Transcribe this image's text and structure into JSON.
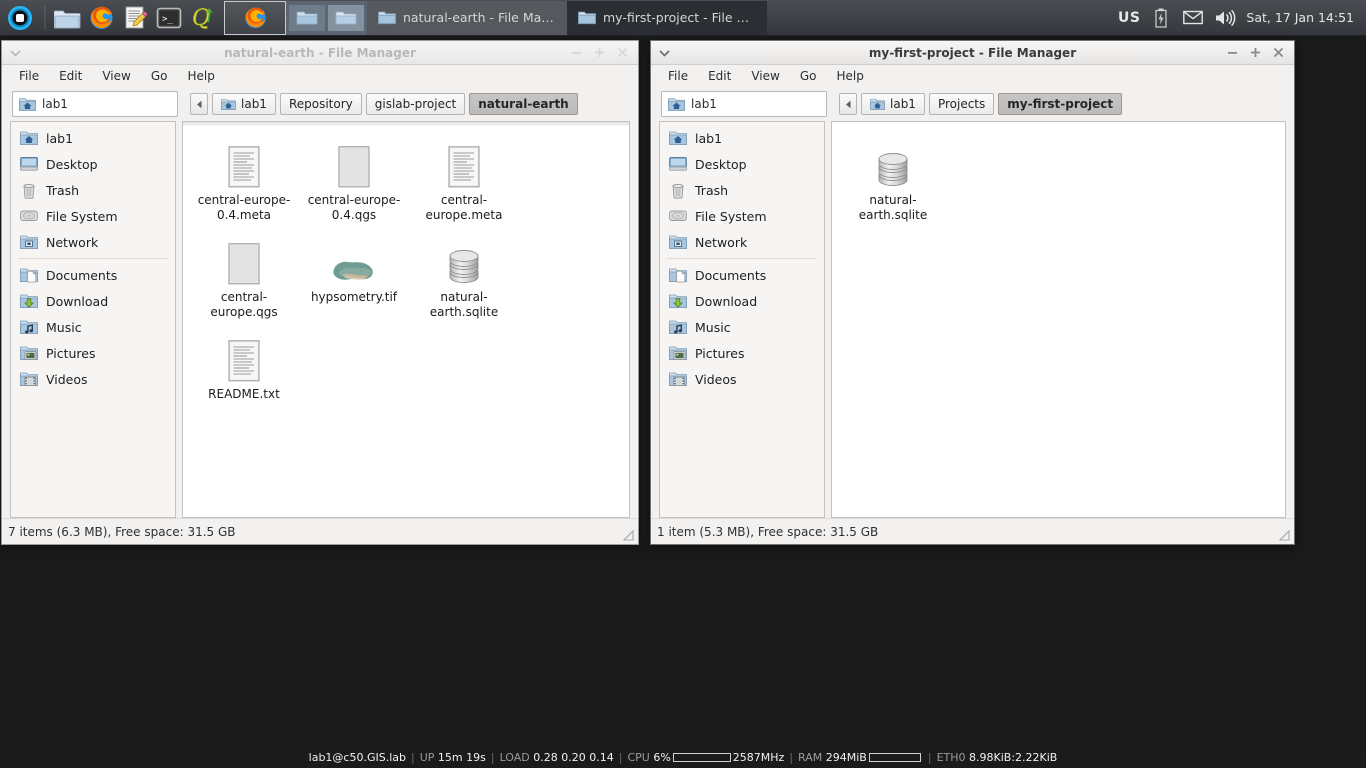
{
  "panel": {
    "launchers": [
      {
        "name": "app-menu-icon",
        "label": "Applications"
      },
      {
        "name": "file-manager-icon",
        "label": "File Manager"
      },
      {
        "name": "firefox-icon",
        "label": "Firefox"
      },
      {
        "name": "text-editor-icon",
        "label": "Text Editor"
      },
      {
        "name": "terminal-icon",
        "label": "Terminal"
      },
      {
        "name": "qgis-icon",
        "label": "QGIS"
      }
    ],
    "window_buttons": [
      {
        "name": "firefox-window-button",
        "label": "",
        "state": "active"
      },
      {
        "name": "natural-earth-window-button",
        "label": "natural-earth - File Manager",
        "state": "inactive"
      },
      {
        "name": "my-first-project-window-button",
        "label": "my-first-project - File Mana...",
        "state": "current"
      }
    ],
    "tray": {
      "keyboard_layout": "US",
      "battery_label": "battery",
      "mail_label": "mail",
      "volume_label": "volume",
      "clock": "Sat, 17 Jan  14:51"
    }
  },
  "menu": [
    "File",
    "Edit",
    "View",
    "Go",
    "Help"
  ],
  "windows": [
    {
      "id": "natural-earth",
      "title": "natural-earth - File Manager",
      "focused": false,
      "location_entry": "lab1",
      "breadcrumbs": [
        "lab1",
        "Repository",
        "gislab-project",
        "natural-earth"
      ],
      "active_breadcrumb": "natural-earth",
      "sidebar": [
        {
          "label": "lab1",
          "icon": "home-folder-icon"
        },
        {
          "label": "Desktop",
          "icon": "desktop-icon"
        },
        {
          "label": "Trash",
          "icon": "trash-icon"
        },
        {
          "label": "File System",
          "icon": "harddisk-icon"
        },
        {
          "label": "Network",
          "icon": "network-icon"
        },
        {
          "label": "Documents",
          "icon": "documents-folder-icon"
        },
        {
          "label": "Download",
          "icon": "download-folder-icon"
        },
        {
          "label": "Music",
          "icon": "music-folder-icon"
        },
        {
          "label": "Pictures",
          "icon": "pictures-folder-icon"
        },
        {
          "label": "Videos",
          "icon": "videos-folder-icon"
        }
      ],
      "files": [
        {
          "label": "central-europe-0.4.meta",
          "icon": "text-file-icon"
        },
        {
          "label": "central-europe-0.4.qgs",
          "icon": "blank-file-icon"
        },
        {
          "label": "central-europe.meta",
          "icon": "text-file-icon"
        },
        {
          "label": "central-europe.qgs",
          "icon": "blank-file-icon"
        },
        {
          "label": "hypsometry.tif",
          "icon": "raster-thumbnail-icon"
        },
        {
          "label": "natural-earth.sqlite",
          "icon": "database-icon"
        },
        {
          "label": "README.txt",
          "icon": "text-file-icon"
        }
      ],
      "status": "7 items (6.3 MB), Free space: 31.5 GB"
    },
    {
      "id": "my-first-project",
      "title": "my-first-project - File Manager",
      "focused": true,
      "location_entry": "lab1",
      "breadcrumbs": [
        "lab1",
        "Projects",
        "my-first-project"
      ],
      "active_breadcrumb": "my-first-project",
      "sidebar": [
        {
          "label": "lab1",
          "icon": "home-folder-icon"
        },
        {
          "label": "Desktop",
          "icon": "desktop-icon"
        },
        {
          "label": "Trash",
          "icon": "trash-icon"
        },
        {
          "label": "File System",
          "icon": "harddisk-icon"
        },
        {
          "label": "Network",
          "icon": "network-icon"
        },
        {
          "label": "Documents",
          "icon": "documents-folder-icon"
        },
        {
          "label": "Download",
          "icon": "download-folder-icon"
        },
        {
          "label": "Music",
          "icon": "music-folder-icon"
        },
        {
          "label": "Pictures",
          "icon": "pictures-folder-icon"
        },
        {
          "label": "Videos",
          "icon": "videos-folder-icon"
        }
      ],
      "files": [
        {
          "label": "natural-earth.sqlite",
          "icon": "database-icon"
        }
      ],
      "status": "1 item (5.3 MB), Free space: 31.5 GB"
    }
  ],
  "bottom_bar": {
    "host": "lab1@c50.GIS.lab",
    "uptime_key": "UP",
    "uptime_value": "15m 19s",
    "load_key": "LOAD",
    "load_value": "0.28 0.20 0.14",
    "cpu_key": "CPU",
    "cpu_value": "6%",
    "cpu_freq": "2587MHz",
    "ram_key": "RAM",
    "ram_value": "294MiB",
    "eth_key": "ETH0",
    "eth_value": "8.98KiB:2.22KiB"
  },
  "colors": {
    "desktop": "#1a1a1a",
    "panel": "#3f4347",
    "window_bg": "#f2f1f0",
    "active_crumb": "#c4c2c0"
  }
}
